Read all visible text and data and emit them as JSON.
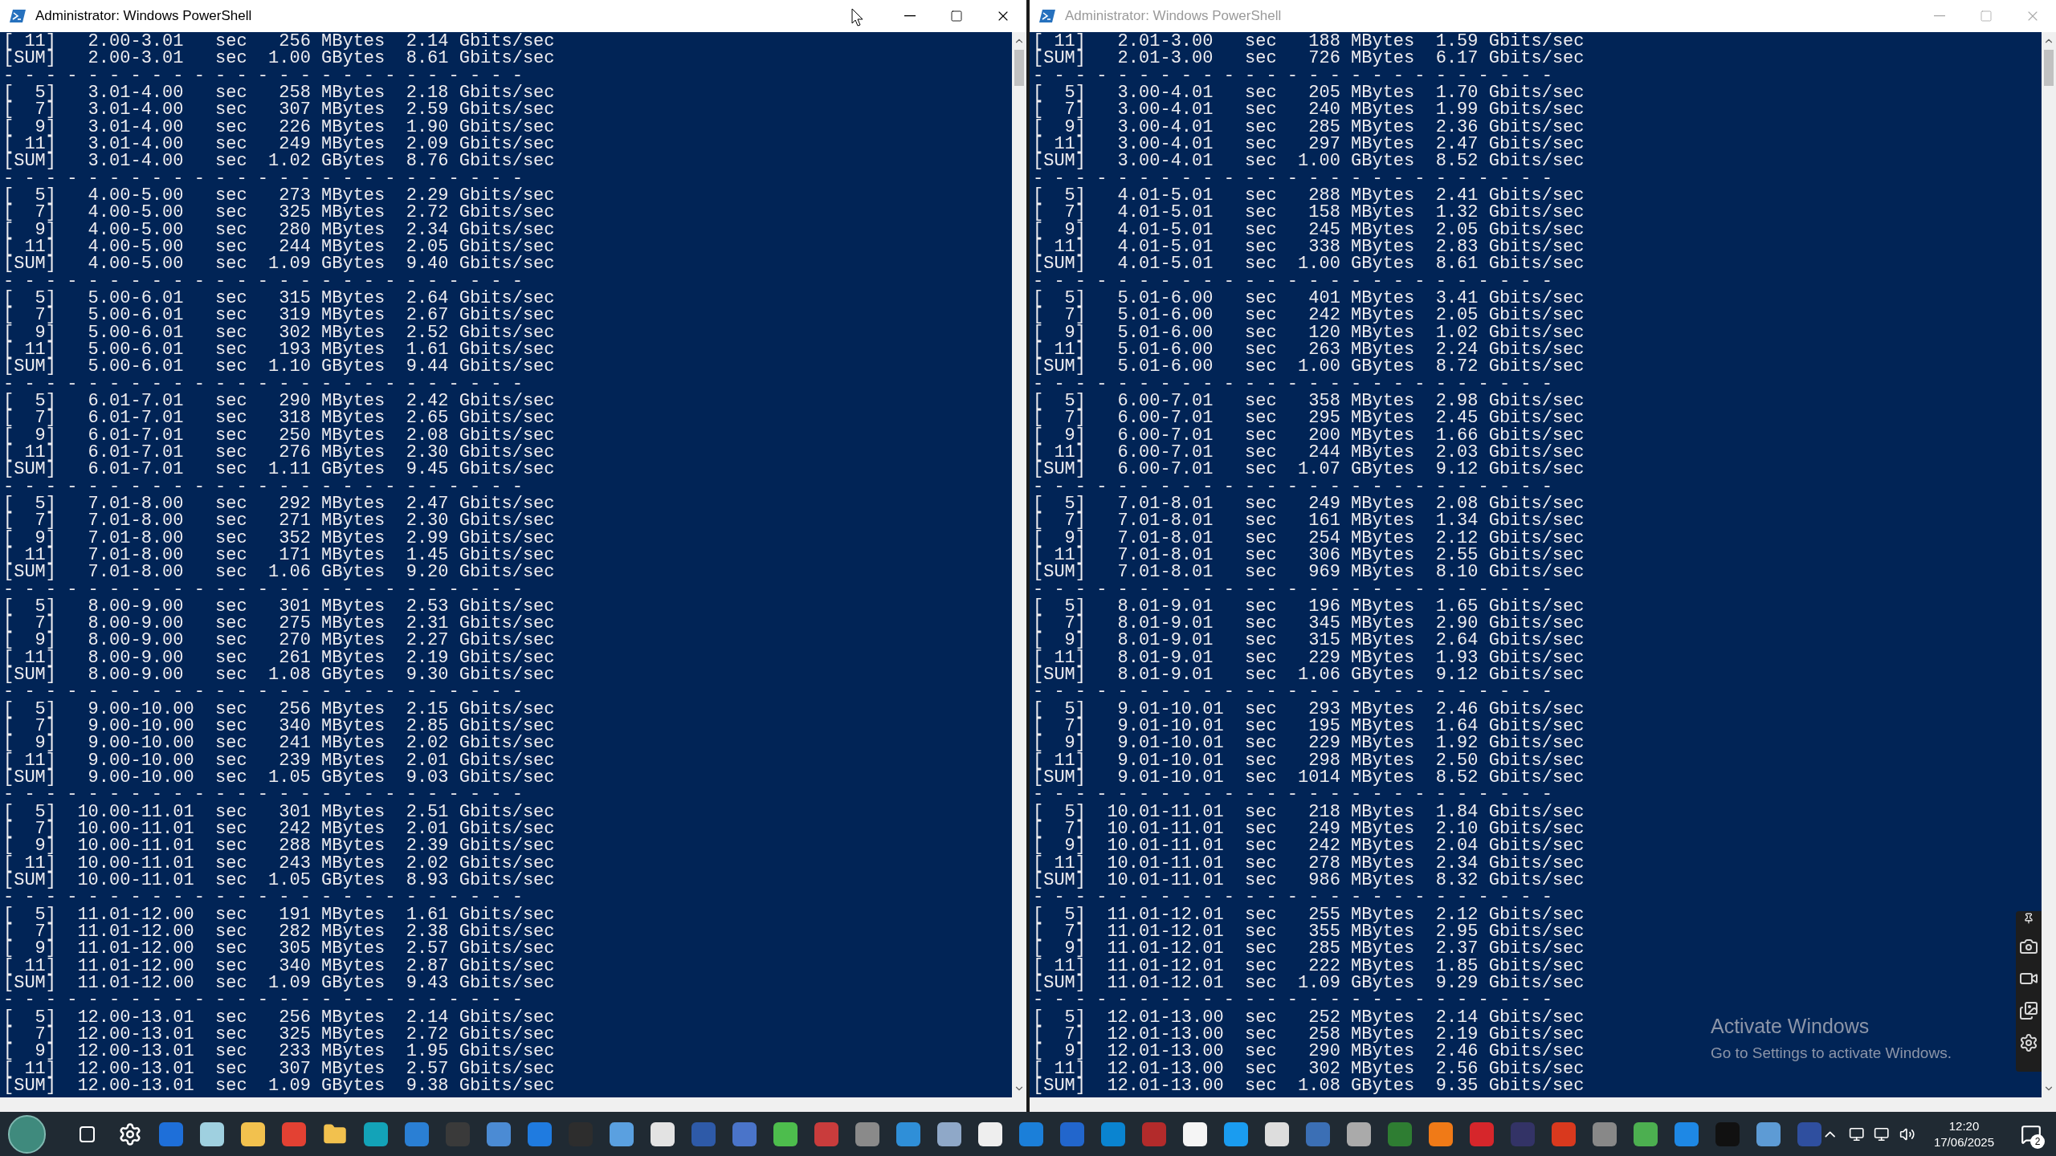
{
  "windows": [
    {
      "title": "Administrator: Windows PowerShell",
      "active": true,
      "lines": [
        "[ 11]   2.00-3.01   sec   256 MBytes  2.14 Gbits/sec",
        "[SUM]   2.00-3.01   sec  1.00 GBytes  8.61 Gbits/sec",
        "- - - - - - - - - - - - - - - - - - - - - - - - -",
        "[  5]   3.01-4.00   sec   258 MBytes  2.18 Gbits/sec",
        "[  7]   3.01-4.00   sec   307 MBytes  2.59 Gbits/sec",
        "[  9]   3.01-4.00   sec   226 MBytes  1.90 Gbits/sec",
        "[ 11]   3.01-4.00   sec   249 MBytes  2.09 Gbits/sec",
        "[SUM]   3.01-4.00   sec  1.02 GBytes  8.76 Gbits/sec",
        "- - - - - - - - - - - - - - - - - - - - - - - - -",
        "[  5]   4.00-5.00   sec   273 MBytes  2.29 Gbits/sec",
        "[  7]   4.00-5.00   sec   325 MBytes  2.72 Gbits/sec",
        "[  9]   4.00-5.00   sec   280 MBytes  2.34 Gbits/sec",
        "[ 11]   4.00-5.00   sec   244 MBytes  2.05 Gbits/sec",
        "[SUM]   4.00-5.00   sec  1.09 GBytes  9.40 Gbits/sec",
        "- - - - - - - - - - - - - - - - - - - - - - - - -",
        "[  5]   5.00-6.01   sec   315 MBytes  2.64 Gbits/sec",
        "[  7]   5.00-6.01   sec   319 MBytes  2.67 Gbits/sec",
        "[  9]   5.00-6.01   sec   302 MBytes  2.52 Gbits/sec",
        "[ 11]   5.00-6.01   sec   193 MBytes  1.61 Gbits/sec",
        "[SUM]   5.00-6.01   sec  1.10 GBytes  9.44 Gbits/sec",
        "- - - - - - - - - - - - - - - - - - - - - - - - -",
        "[  5]   6.01-7.01   sec   290 MBytes  2.42 Gbits/sec",
        "[  7]   6.01-7.01   sec   318 MBytes  2.65 Gbits/sec",
        "[  9]   6.01-7.01   sec   250 MBytes  2.08 Gbits/sec",
        "[ 11]   6.01-7.01   sec   276 MBytes  2.30 Gbits/sec",
        "[SUM]   6.01-7.01   sec  1.11 GBytes  9.45 Gbits/sec",
        "- - - - - - - - - - - - - - - - - - - - - - - - -",
        "[  5]   7.01-8.00   sec   292 MBytes  2.47 Gbits/sec",
        "[  7]   7.01-8.00   sec   271 MBytes  2.30 Gbits/sec",
        "[  9]   7.01-8.00   sec   352 MBytes  2.99 Gbits/sec",
        "[ 11]   7.01-8.00   sec   171 MBytes  1.45 Gbits/sec",
        "[SUM]   7.01-8.00   sec  1.06 GBytes  9.20 Gbits/sec",
        "- - - - - - - - - - - - - - - - - - - - - - - - -",
        "[  5]   8.00-9.00   sec   301 MBytes  2.53 Gbits/sec",
        "[  7]   8.00-9.00   sec   275 MBytes  2.31 Gbits/sec",
        "[  9]   8.00-9.00   sec   270 MBytes  2.27 Gbits/sec",
        "[ 11]   8.00-9.00   sec   261 MBytes  2.19 Gbits/sec",
        "[SUM]   8.00-9.00   sec  1.08 GBytes  9.30 Gbits/sec",
        "- - - - - - - - - - - - - - - - - - - - - - - - -",
        "[  5]   9.00-10.00  sec   256 MBytes  2.15 Gbits/sec",
        "[  7]   9.00-10.00  sec   340 MBytes  2.85 Gbits/sec",
        "[  9]   9.00-10.00  sec   241 MBytes  2.02 Gbits/sec",
        "[ 11]   9.00-10.00  sec   239 MBytes  2.01 Gbits/sec",
        "[SUM]   9.00-10.00  sec  1.05 GBytes  9.03 Gbits/sec",
        "- - - - - - - - - - - - - - - - - - - - - - - - -",
        "[  5]  10.00-11.01  sec   301 MBytes  2.51 Gbits/sec",
        "[  7]  10.00-11.01  sec   242 MBytes  2.01 Gbits/sec",
        "[  9]  10.00-11.01  sec   288 MBytes  2.39 Gbits/sec",
        "[ 11]  10.00-11.01  sec   243 MBytes  2.02 Gbits/sec",
        "[SUM]  10.00-11.01  sec  1.05 GBytes  8.93 Gbits/sec",
        "- - - - - - - - - - - - - - - - - - - - - - - - -",
        "[  5]  11.01-12.00  sec   191 MBytes  1.61 Gbits/sec",
        "[  7]  11.01-12.00  sec   282 MBytes  2.38 Gbits/sec",
        "[  9]  11.01-12.00  sec   305 MBytes  2.57 Gbits/sec",
        "[ 11]  11.01-12.00  sec   340 MBytes  2.87 Gbits/sec",
        "[SUM]  11.01-12.00  sec  1.09 GBytes  9.43 Gbits/sec",
        "- - - - - - - - - - - - - - - - - - - - - - - - -",
        "[  5]  12.00-13.01  sec   256 MBytes  2.14 Gbits/sec",
        "[  7]  12.00-13.01  sec   325 MBytes  2.72 Gbits/sec",
        "[  9]  12.00-13.01  sec   233 MBytes  1.95 Gbits/sec",
        "[ 11]  12.00-13.01  sec   307 MBytes  2.57 Gbits/sec",
        "[SUM]  12.00-13.01  sec  1.09 GBytes  9.38 Gbits/sec"
      ]
    },
    {
      "title": "Administrator: Windows PowerShell",
      "active": false,
      "lines": [
        "[ 11]   2.01-3.00   sec   188 MBytes  1.59 Gbits/sec",
        "[SUM]   2.01-3.00   sec   726 MBytes  6.17 Gbits/sec",
        "- - - - - - - - - - - - - - - - - - - - - - - - -",
        "[  5]   3.00-4.01   sec   205 MBytes  1.70 Gbits/sec",
        "[  7]   3.00-4.01   sec   240 MBytes  1.99 Gbits/sec",
        "[  9]   3.00-4.01   sec   285 MBytes  2.36 Gbits/sec",
        "[ 11]   3.00-4.01   sec   297 MBytes  2.47 Gbits/sec",
        "[SUM]   3.00-4.01   sec  1.00 GBytes  8.52 Gbits/sec",
        "- - - - - - - - - - - - - - - - - - - - - - - - -",
        "[  5]   4.01-5.01   sec   288 MBytes  2.41 Gbits/sec",
        "[  7]   4.01-5.01   sec   158 MBytes  1.32 Gbits/sec",
        "[  9]   4.01-5.01   sec   245 MBytes  2.05 Gbits/sec",
        "[ 11]   4.01-5.01   sec   338 MBytes  2.83 Gbits/sec",
        "[SUM]   4.01-5.01   sec  1.00 GBytes  8.61 Gbits/sec",
        "- - - - - - - - - - - - - - - - - - - - - - - - -",
        "[  5]   5.01-6.00   sec   401 MBytes  3.41 Gbits/sec",
        "[  7]   5.01-6.00   sec   242 MBytes  2.05 Gbits/sec",
        "[  9]   5.01-6.00   sec   120 MBytes  1.02 Gbits/sec",
        "[ 11]   5.01-6.00   sec   263 MBytes  2.24 Gbits/sec",
        "[SUM]   5.01-6.00   sec  1.00 GBytes  8.72 Gbits/sec",
        "- - - - - - - - - - - - - - - - - - - - - - - - -",
        "[  5]   6.00-7.01   sec   358 MBytes  2.98 Gbits/sec",
        "[  7]   6.00-7.01   sec   295 MBytes  2.45 Gbits/sec",
        "[  9]   6.00-7.01   sec   200 MBytes  1.66 Gbits/sec",
        "[ 11]   6.00-7.01   sec   244 MBytes  2.03 Gbits/sec",
        "[SUM]   6.00-7.01   sec  1.07 GBytes  9.12 Gbits/sec",
        "- - - - - - - - - - - - - - - - - - - - - - - - -",
        "[  5]   7.01-8.01   sec   249 MBytes  2.08 Gbits/sec",
        "[  7]   7.01-8.01   sec   161 MBytes  1.34 Gbits/sec",
        "[  9]   7.01-8.01   sec   254 MBytes  2.12 Gbits/sec",
        "[ 11]   7.01-8.01   sec   306 MBytes  2.55 Gbits/sec",
        "[SUM]   7.01-8.01   sec   969 MBytes  8.10 Gbits/sec",
        "- - - - - - - - - - - - - - - - - - - - - - - - -",
        "[  5]   8.01-9.01   sec   196 MBytes  1.65 Gbits/sec",
        "[  7]   8.01-9.01   sec   345 MBytes  2.90 Gbits/sec",
        "[  9]   8.01-9.01   sec   315 MBytes  2.64 Gbits/sec",
        "[ 11]   8.01-9.01   sec   229 MBytes  1.93 Gbits/sec",
        "[SUM]   8.01-9.01   sec  1.06 GBytes  9.12 Gbits/sec",
        "- - - - - - - - - - - - - - - - - - - - - - - - -",
        "[  5]   9.01-10.01  sec   293 MBytes  2.46 Gbits/sec",
        "[  7]   9.01-10.01  sec   195 MBytes  1.64 Gbits/sec",
        "[  9]   9.01-10.01  sec   229 MBytes  1.92 Gbits/sec",
        "[ 11]   9.01-10.01  sec   298 MBytes  2.50 Gbits/sec",
        "[SUM]   9.01-10.01  sec  1014 MBytes  8.52 Gbits/sec",
        "- - - - - - - - - - - - - - - - - - - - - - - - -",
        "[  5]  10.01-11.01  sec   218 MBytes  1.84 Gbits/sec",
        "[  7]  10.01-11.01  sec   249 MBytes  2.10 Gbits/sec",
        "[  9]  10.01-11.01  sec   242 MBytes  2.04 Gbits/sec",
        "[ 11]  10.01-11.01  sec   278 MBytes  2.34 Gbits/sec",
        "[SUM]  10.01-11.01  sec   986 MBytes  8.32 Gbits/sec",
        "- - - - - - - - - - - - - - - - - - - - - - - - -",
        "[  5]  11.01-12.01  sec   255 MBytes  2.12 Gbits/sec",
        "[  7]  11.01-12.01  sec   355 MBytes  2.95 Gbits/sec",
        "[  9]  11.01-12.01  sec   285 MBytes  2.37 Gbits/sec",
        "[ 11]  11.01-12.01  sec   222 MBytes  1.85 Gbits/sec",
        "[SUM]  11.01-12.01  sec  1.09 GBytes  9.29 Gbits/sec",
        "- - - - - - - - - - - - - - - - - - - - - - - - -",
        "[  5]  12.01-13.00  sec   252 MBytes  2.14 Gbits/sec",
        "[  7]  12.01-13.00  sec   258 MBytes  2.19 Gbits/sec",
        "[  9]  12.01-13.00  sec   290 MBytes  2.46 Gbits/sec",
        "[ 11]  12.01-13.00  sec   302 MBytes  2.56 Gbits/sec",
        "[SUM]  12.01-13.00  sec  1.08 GBytes  9.35 Gbits/sec"
      ]
    }
  ],
  "activation": {
    "title": "Activate Windows",
    "subtitle": "Go to Settings to activate Windows."
  },
  "taskbar": {
    "time": "12:20",
    "date": "17/06/2025",
    "notifications": "2"
  }
}
